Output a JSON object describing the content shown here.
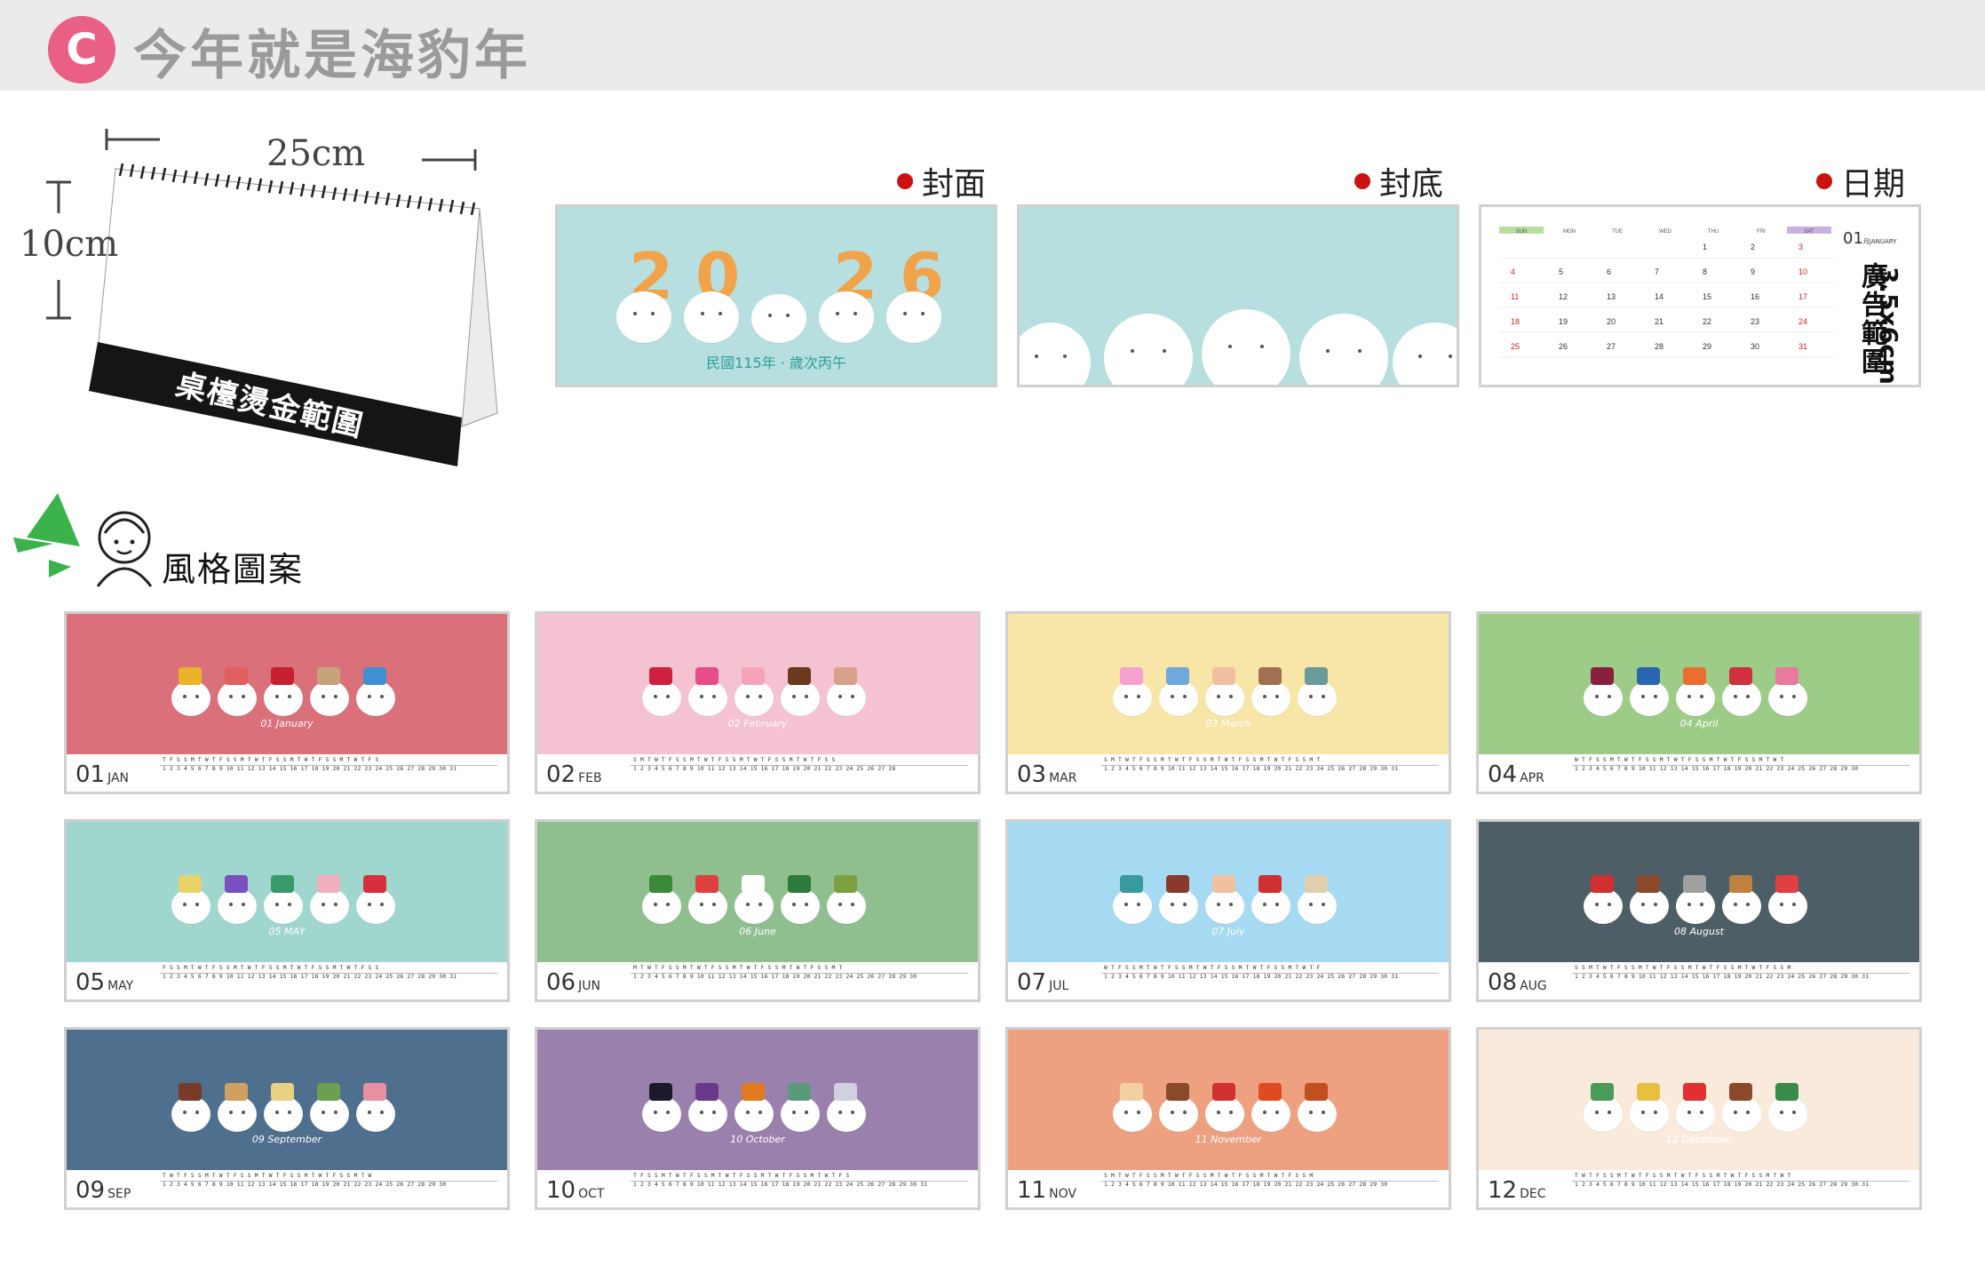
{
  "header": {
    "badge": "C",
    "title": "今年就是海豹年"
  },
  "product": {
    "width_label": "25cm",
    "height_label": "10cm",
    "stamp_label": "桌檯燙金範圍"
  },
  "previews": {
    "cover": {
      "label": "封面",
      "year_digits": [
        "2",
        "0",
        "2",
        "6"
      ],
      "subtitle": "民國115年 · 歲次丙午"
    },
    "back": {
      "label": "封底"
    },
    "date": {
      "label": "日期",
      "month_num": "01",
      "month_en": "月JANUARY",
      "ad_range": "廣告範圍",
      "ad_dim": "3.5x6cm",
      "weekdays": [
        "SUN",
        "MON",
        "TUE",
        "WED",
        "THU",
        "FRI",
        "SAT"
      ],
      "rows": [
        [
          "",
          "",
          "",
          "",
          "1",
          "2",
          "3"
        ],
        [
          "4",
          "5",
          "6",
          "7",
          "8",
          "9",
          "10"
        ],
        [
          "11",
          "12",
          "13",
          "14",
          "15",
          "16",
          "17"
        ],
        [
          "18",
          "19",
          "20",
          "21",
          "22",
          "23",
          "24"
        ],
        [
          "25",
          "26",
          "27",
          "28",
          "29",
          "30",
          "31"
        ]
      ]
    }
  },
  "style_section": {
    "title": "風格圖案"
  },
  "months": [
    {
      "num": "01",
      "abbr": "JAN",
      "name": "January",
      "mname_num": "01",
      "bg": "#d9707a",
      "days": "T F S S M T W T F S S M T W T F S S M T W T F S S M T W T F S\n1 2 3 4 5 6 7 8 9 10 11 12 13 14 15 16 17 18 19 20 21 22 23 24 25 26 27 28 29 30 31",
      "accents": [
        "#e9b32a",
        "#e35f5f",
        "#c8202f",
        "#c7a27a",
        "#3f8fd1"
      ]
    },
    {
      "num": "02",
      "abbr": "FEB",
      "name": "February",
      "mname_num": "02",
      "bg": "#f5c2d1",
      "days": "S M T W T F S S M T W T F S S M T W T F S S M T W T F S S\n1 2 3 4 5 6 7 8 9 10 11 12 13 14 15 16 17 18 19 20 21 22 23 24 25 26 27 28",
      "accents": [
        "#d02040",
        "#e84d8a",
        "#f5a3b8",
        "#6b3a1e",
        "#d8a08a"
      ]
    },
    {
      "num": "03",
      "abbr": "MAR",
      "name": "March",
      "mname_num": "03",
      "bg": "#f7e6a7",
      "days": "S M T W T F S S M T W T F S S M T W T F S S M T W T F S S M T\n1 2 3 4 5 6 7 8 9 10 11 12 13 14 15 16 17 18 19 20 21 22 23 24 25 26 27 28 29 30 31",
      "accents": [
        "#f5a0cf",
        "#6fa8dc",
        "#f0c0a0",
        "#a07050",
        "#6a9a9a"
      ]
    },
    {
      "num": "04",
      "abbr": "APR",
      "name": "April",
      "mname_num": "04",
      "bg": "#9ccc87",
      "days": "W T F S S M T W T F S S M T W T F S S M T W T F S S M T W T\n1 2 3 4 5 6 7 8 9 10 11 12 13 14 15 16 17 18 19 20 21 22 23 24 25 26 27 28 29 30",
      "accents": [
        "#8a2040",
        "#2a66b0",
        "#ea6f2f",
        "#d03040",
        "#e87aa0"
      ]
    },
    {
      "num": "05",
      "abbr": "MAY",
      "name": "MAY",
      "mname_num": "05",
      "bg": "#9fd6cd",
      "days": "F S S M T W T F S S M T W T F S S M T W T F S S M T W T F S S\n1 2 3 4 5 6 7 8 9 10 11 12 13 14 15 16 17 18 19 20 21 22 23 24 25 26 27 28 29 30 31",
      "accents": [
        "#e9d26a",
        "#7a4fbf",
        "#3a9a6a",
        "#f0b0c0",
        "#d8303a"
      ]
    },
    {
      "num": "06",
      "abbr": "JUN",
      "name": "June",
      "mname_num": "06",
      "bg": "#8fbf8f",
      "days": "M T W T F S S M T W T F S S M T W T F S S M T W T F S S M T\n1 2 3 4 5 6 7 8 9 10 11 12 13 14 15 16 17 18 19 20 21 22 23 24 25 26 27 28 29 30",
      "accents": [
        "#3a8a3a",
        "#e04040",
        "#ffffff",
        "#2e7a3a",
        "#7aa040"
      ]
    },
    {
      "num": "07",
      "abbr": "JUL",
      "name": "July",
      "mname_num": "07",
      "bg": "#a6d9f2",
      "days": "W T F S S M T W T F S S M T W T F S S M T W T F S S M T W T F\n1 2 3 4 5 6 7 8 9 10 11 12 13 14 15 16 17 18 19 20 21 22 23 24 25 26 27 28 29 30 31",
      "accents": [
        "#3a9aa0",
        "#8a3a2a",
        "#f0c0a0",
        "#d03030",
        "#e0d0b0"
      ]
    },
    {
      "num": "08",
      "abbr": "AUG",
      "name": "August",
      "mname_num": "08",
      "bg": "#4e5e66",
      "days": "S S M T W T F S S M T W T F S S M T W T F S S M T W T F S S M\n1 2 3 4 5 6 7 8 9 10 11 12 13 14 15 16 17 18 19 20 21 22 23 24 25 26 27 28 29 30 31",
      "accents": [
        "#d03030",
        "#8a4a2a",
        "#a0a0a0",
        "#c08040",
        "#e04040"
      ]
    },
    {
      "num": "09",
      "abbr": "SEP",
      "name": "September",
      "mname_num": "09",
      "bg": "#4f6f8f",
      "days": "T W T F S S M T W T F S S M T W T F S S M T W T F S S M T W\n1 2 3 4 5 6 7 8 9 10 11 12 13 14 15 16 17 18 19 20 21 22 23 24 25 26 27 28 29 30",
      "accents": [
        "#7a3a2a",
        "#d0a060",
        "#e8d080",
        "#6aa050",
        "#e890a0"
      ]
    },
    {
      "num": "10",
      "abbr": "OCT",
      "name": "October",
      "mname_num": "10",
      "bg": "#9a80ad",
      "days": "T F S S M T W T F S S M T W T F S S M T W T F S S M T W T F S\n1 2 3 4 5 6 7 8 9 10 11 12 13 14 15 16 17 18 19 20 21 22 23 24 25 26 27 28 29 30 31",
      "accents": [
        "#1a1a2a",
        "#6a3a8a",
        "#e07a20",
        "#5a9a7a",
        "#d0d0e0"
      ]
    },
    {
      "num": "11",
      "abbr": "NOV",
      "name": "November",
      "mname_num": "11",
      "bg": "#eea180",
      "days": "S M T W T F S S M T W T F S S M T W T F S S M T W T F S S M\n1 2 3 4 5 6 7 8 9 10 11 12 13 14 15 16 17 18 19 20 21 22 23 24 25 26 27 28 29 30",
      "accents": [
        "#f0d0a0",
        "#8a4a2a",
        "#d03030",
        "#e04a20",
        "#c05020"
      ]
    },
    {
      "num": "12",
      "abbr": "DEC",
      "name": "December",
      "mname_num": "12",
      "bg": "#faeadc",
      "days": "T W T F S S M T W T F S S M T W T F S S M T W T F S S M T W T\n1 2 3 4 5 6 7 8 9 10 11 12 13 14 15 16 17 18 19 20 21 22 23 24 25 26 27 28 29 30 31",
      "accents": [
        "#4a9a5a",
        "#e8c040",
        "#e03030",
        "#8a4a2a",
        "#3a8a4a"
      ]
    }
  ]
}
